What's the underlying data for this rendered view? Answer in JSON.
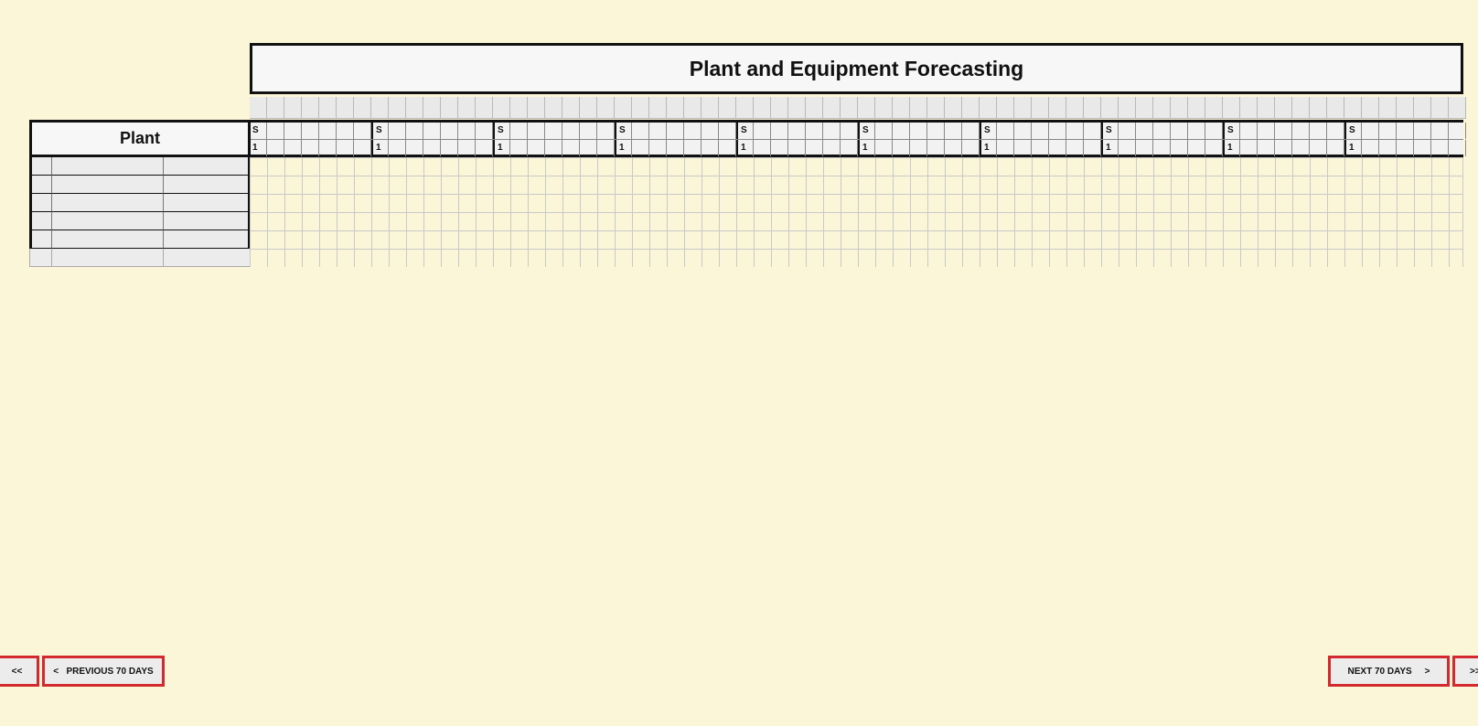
{
  "title": "Plant and Equipment Forecasting",
  "plant_header": "Plant",
  "header_row": {
    "day_letter": "S",
    "day_number": "1"
  },
  "buttons": {
    "first": "<<",
    "previous": "<   PREVIOUS 70 DAYS",
    "next": "NEXT 70 DAYS     >",
    "last": ">>"
  }
}
